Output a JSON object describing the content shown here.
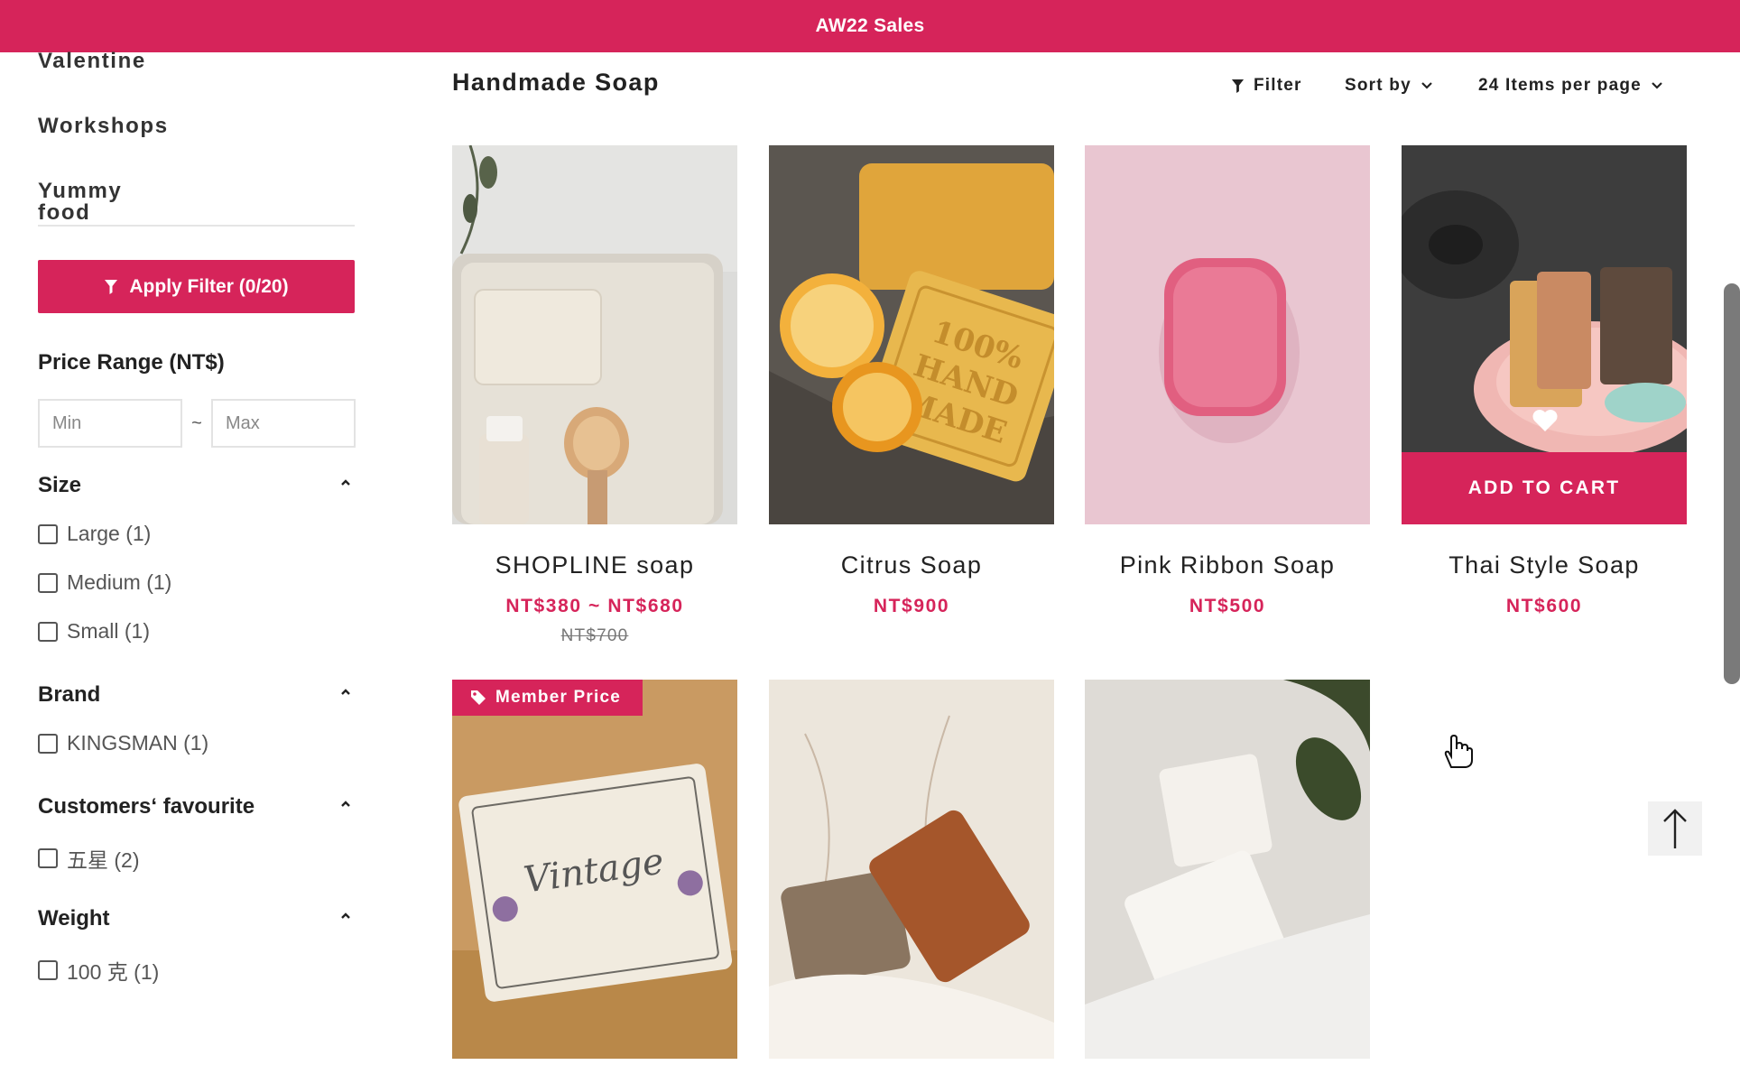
{
  "announcement": "AW22 Sales",
  "sidebar": {
    "categories": [
      "Valentine",
      "Workshops",
      "Yummy food"
    ],
    "apply_filter_label": "Apply Filter (0/20)",
    "price_range": {
      "title": "Price Range (NT$)",
      "min_placeholder": "Min",
      "max_placeholder": "Max",
      "separator": "~"
    },
    "filters": [
      {
        "title": "Size",
        "options": [
          "Large (1)",
          "Medium (1)",
          "Small (1)"
        ]
      },
      {
        "title": "Brand",
        "options": [
          "KINGSMAN (1)"
        ]
      },
      {
        "title": "Customers‘ favourite",
        "options": [
          "五星 (2)"
        ]
      },
      {
        "title": "Weight",
        "options": [
          "100 克 (1)"
        ]
      }
    ]
  },
  "main": {
    "title": "Handmade Soap",
    "toolbar": {
      "filter_label": "Filter",
      "sort_label": "Sort by",
      "per_page_label": "24 Items per page"
    },
    "products": [
      {
        "name": "SHOPLINE soap",
        "price": "NT$380 ~ NT$680",
        "old_price": "NT$700"
      },
      {
        "name": "Citrus Soap",
        "price": "NT$900"
      },
      {
        "name": "Pink Ribbon Soap",
        "price": "NT$500"
      },
      {
        "name": "Thai Style Soap",
        "price": "NT$600",
        "add_to_cart": "ADD TO CART"
      },
      {
        "badge": "Member Price"
      },
      {},
      {}
    ]
  },
  "colors": {
    "brand": "#d6245a"
  },
  "icons": [
    "filter-icon",
    "chevron-down-icon",
    "chevron-up-icon",
    "heart-icon",
    "tag-icon",
    "arrow-up-icon",
    "hand-cursor-icon"
  ]
}
